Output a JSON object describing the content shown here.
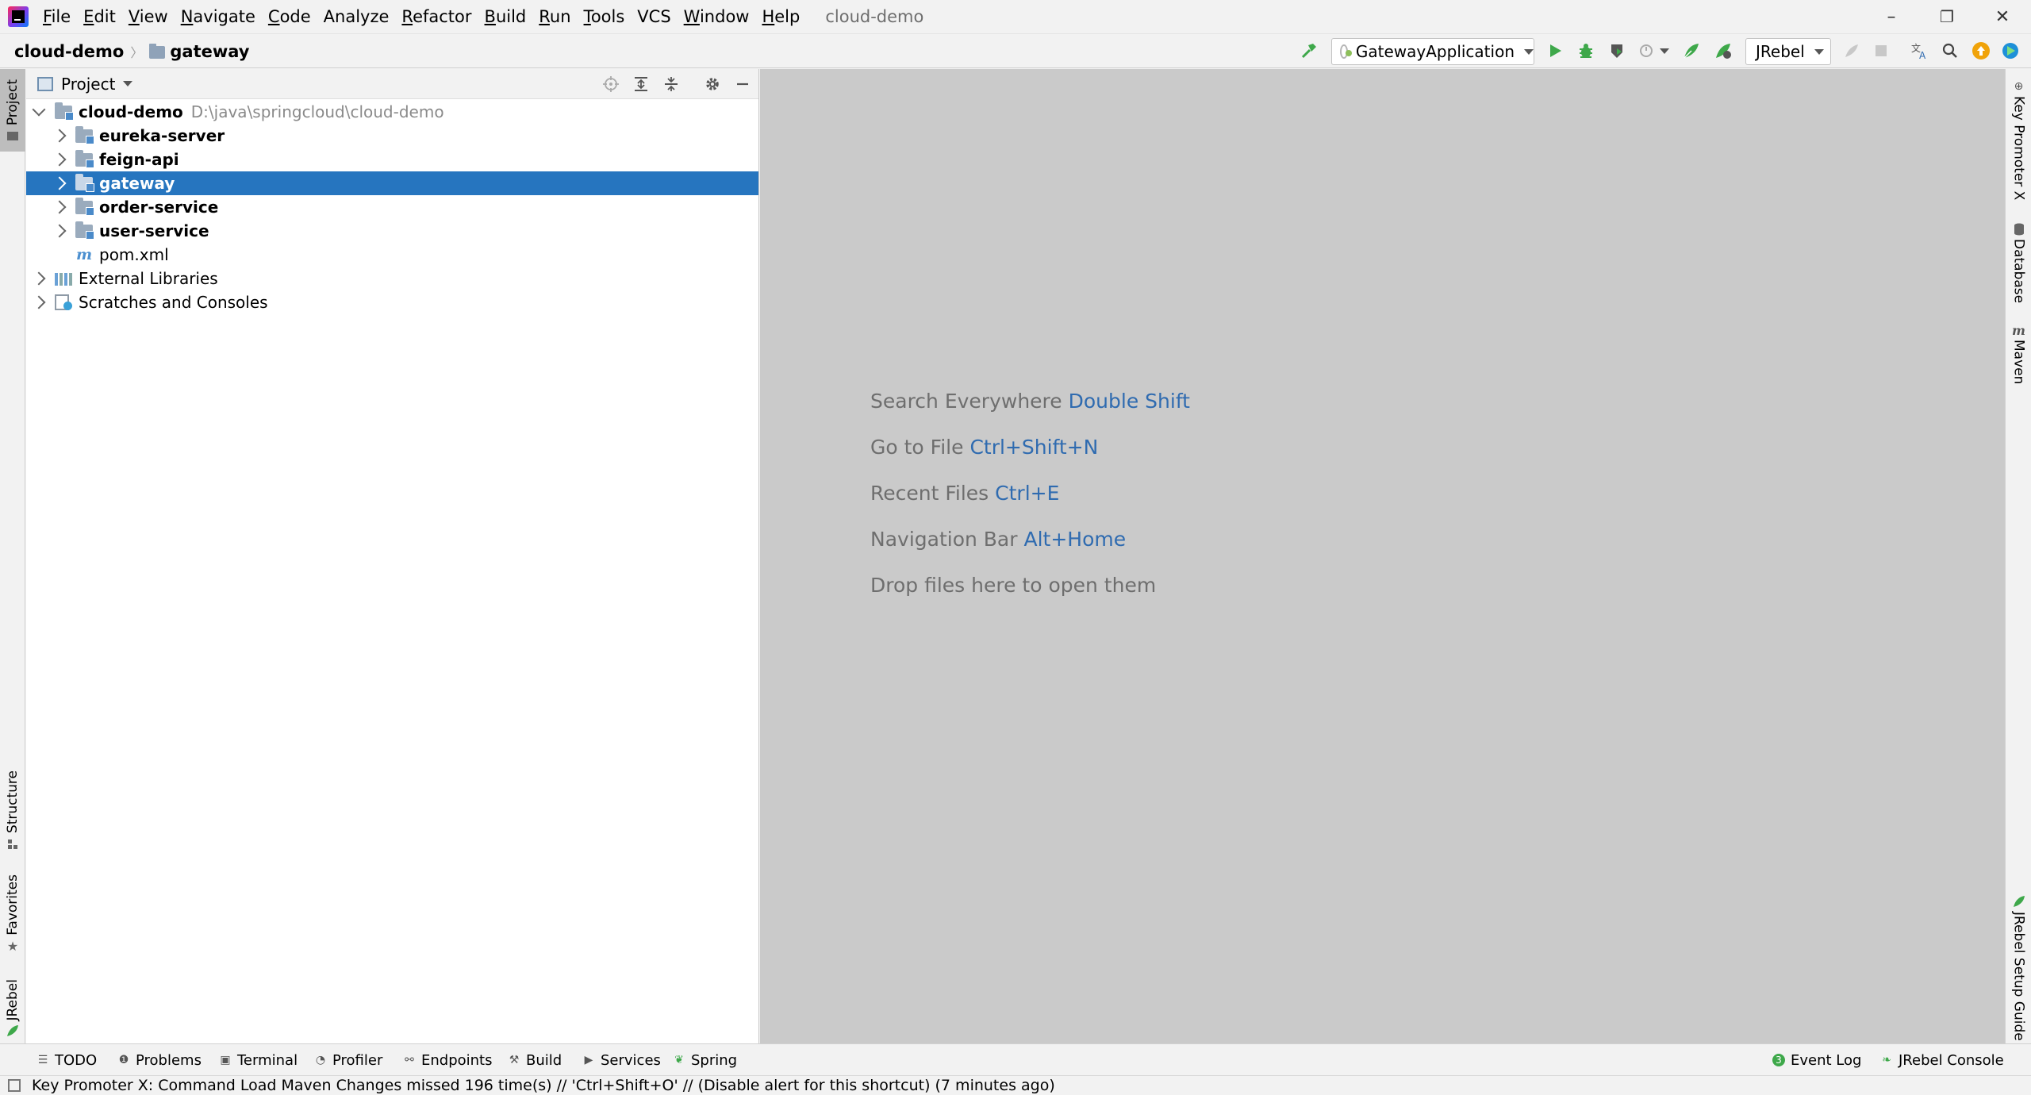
{
  "window": {
    "title": "cloud-demo",
    "minimize": "–",
    "restore": "❐",
    "close": "✕"
  },
  "menu": [
    {
      "mnemonic": "F",
      "rest": "ile"
    },
    {
      "mnemonic": "E",
      "rest": "dit"
    },
    {
      "mnemonic": "V",
      "rest": "iew"
    },
    {
      "mnemonic": "N",
      "rest": "avigate"
    },
    {
      "mnemonic": "C",
      "rest": "ode"
    },
    {
      "mnemonic": "",
      "rest": "Analyze"
    },
    {
      "mnemonic": "R",
      "rest": "efactor"
    },
    {
      "mnemonic": "B",
      "rest": "uild"
    },
    {
      "mnemonic": "R",
      "rest": "un"
    },
    {
      "mnemonic": "T",
      "rest": "ools"
    },
    {
      "mnemonic": "",
      "rest": "VCS"
    },
    {
      "mnemonic": "W",
      "rest": "indow"
    },
    {
      "mnemonic": "H",
      "rest": "elp"
    }
  ],
  "breadcrumb": {
    "project": "cloud-demo",
    "module": "gateway"
  },
  "toolbar": {
    "run_config": "GatewayApplication",
    "jrebel_mode": "JRebel"
  },
  "left_tabs": {
    "project": "Project",
    "structure": "Structure",
    "favorites": "Favorites",
    "jrebel": "JRebel"
  },
  "right_tabs": {
    "key_promoter": "Key Promoter X",
    "database": "Database",
    "maven": "Maven",
    "jrebel_setup": "JRebel Setup Guide"
  },
  "project_panel": {
    "title": "Project",
    "root": {
      "name": "cloud-demo",
      "path": "D:\\java\\springcloud\\cloud-demo"
    },
    "modules": [
      "eureka-server",
      "feign-api",
      "gateway",
      "order-service",
      "user-service"
    ],
    "pom": "pom.xml",
    "external_libraries": "External Libraries",
    "scratches": "Scratches and Consoles"
  },
  "editor_hints": [
    {
      "text": "Search Everywhere",
      "key": "Double Shift"
    },
    {
      "text": "Go to File",
      "key": "Ctrl+Shift+N"
    },
    {
      "text": "Recent Files",
      "key": "Ctrl+E"
    },
    {
      "text": "Navigation Bar",
      "key": "Alt+Home"
    },
    {
      "text": "Drop files here to open them",
      "key": ""
    }
  ],
  "bottom_tools": {
    "todo": "TODO",
    "problems": "Problems",
    "terminal": "Terminal",
    "profiler": "Profiler",
    "endpoints": "Endpoints",
    "build": "Build",
    "services": "Services",
    "spring": "Spring",
    "event_log": "Event Log",
    "event_log_count": "3",
    "jrebel_console": "JRebel Console"
  },
  "status": {
    "message": "Key Promoter X: Command Load Maven Changes missed 196 time(s) // 'Ctrl+Shift+O' // (Disable alert for this shortcut) (7 minutes ago)"
  },
  "colors": {
    "selection": "#2675bf",
    "editor_bg": "#cacaca",
    "hint_key": "#2f6bb0",
    "run_green": "#3ea84a"
  }
}
